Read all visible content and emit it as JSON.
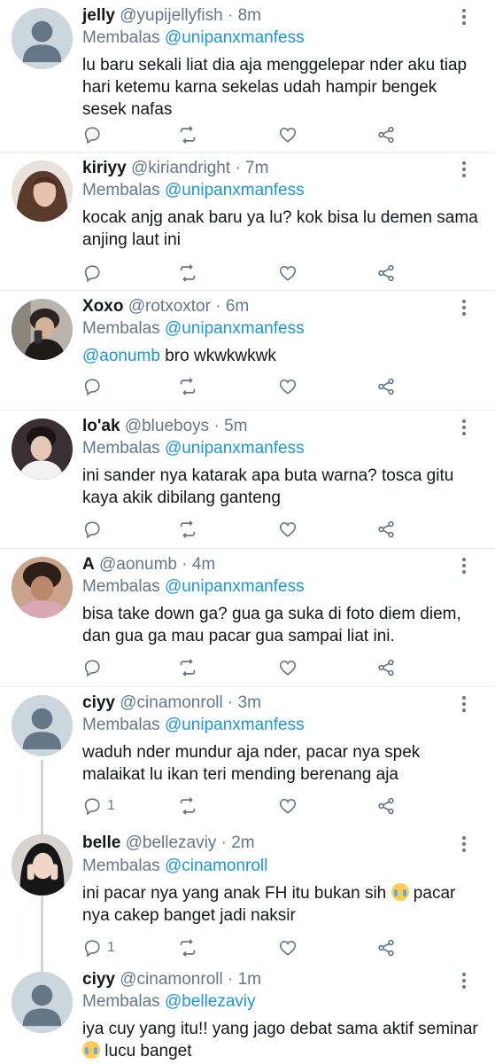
{
  "tweets": [
    {
      "name": "jelly",
      "handle": "@yupijellyfish",
      "time": "8m",
      "reply_prefix": "Membalas",
      "reply_to": "@unipanxmanfess",
      "text": "lu baru sekali liat dia aja menggelepar nder aku tiap hari ketemu karna sekelas udah hampir bengek sesek nafas",
      "reply_count": "",
      "avatar": "default-avatar"
    },
    {
      "name": "kiriyy",
      "handle": "@kiriandright",
      "time": "7m",
      "reply_prefix": "Membalas",
      "reply_to": "@unipanxmanfess",
      "text": "kocak anjg anak baru ya lu? kok bisa lu demen sama anjing laut ini",
      "reply_count": "",
      "avatar": "photo-avatar"
    },
    {
      "name": "Xoxo",
      "handle": "@rotxoxtor",
      "time": "6m",
      "reply_prefix": "Membalas",
      "reply_to": "@unipanxmanfess",
      "text_mention": "@aonumb",
      "text": " bro wkwkwkwk",
      "reply_count": "",
      "avatar": "photo-avatar"
    },
    {
      "name": "lo'ak",
      "handle": "@blueboys",
      "time": "5m",
      "reply_prefix": "Membalas",
      "reply_to": "@unipanxmanfess",
      "text": "ini sander nya katarak apa buta warna? tosca gitu kaya akik dibilang ganteng",
      "reply_count": "",
      "avatar": "photo-avatar"
    },
    {
      "name": "A",
      "handle": "@aonumb",
      "time": "4m",
      "reply_prefix": "Membalas",
      "reply_to": "@unipanxmanfess",
      "text": "bisa take down ga? gua ga suka di foto diem diem, dan gua ga mau pacar gua sampai liat ini.",
      "reply_count": "",
      "avatar": "photo-avatar"
    },
    {
      "name": "ciyy",
      "handle": "@cinamonroll",
      "time": "3m",
      "reply_prefix": "Membalas",
      "reply_to": "@unipanxmanfess",
      "text": "waduh nder mundur aja nder, pacar nya spek malaikat lu ikan teri mending berenang aja",
      "reply_count": "1",
      "avatar": "default-avatar"
    },
    {
      "name": "belle",
      "handle": "@bellezaviy",
      "time": "2m",
      "reply_prefix": "Membalas",
      "reply_to": "@cinamonroll",
      "text_a": "ini pacar nya yang anak FH itu bukan sih ",
      "emoji": "loudly-crying-face",
      "text_b": " pacar nya cakep banget jadi naksir",
      "reply_count": "1",
      "avatar": "photo-avatar"
    },
    {
      "name": "ciyy",
      "handle": "@cinamonroll",
      "time": "1m",
      "reply_prefix": "Membalas",
      "reply_to": "@bellezaviy",
      "text_a": "iya cuy yang itu!! yang jago debat sama aktif seminar ",
      "emoji": "loudly-crying-face",
      "text_b": " lucu banget",
      "reply_count": "",
      "avatar": "default-avatar"
    }
  ],
  "colors": {
    "name": "#14171a",
    "secondary": "#657786",
    "link": "#1b95e0",
    "divider": "#e6ecf0",
    "avatar_bg": "#ccd6dd"
  },
  "icons": [
    "reply-icon",
    "retweet-icon",
    "like-icon",
    "share-icon",
    "more-icon"
  ]
}
